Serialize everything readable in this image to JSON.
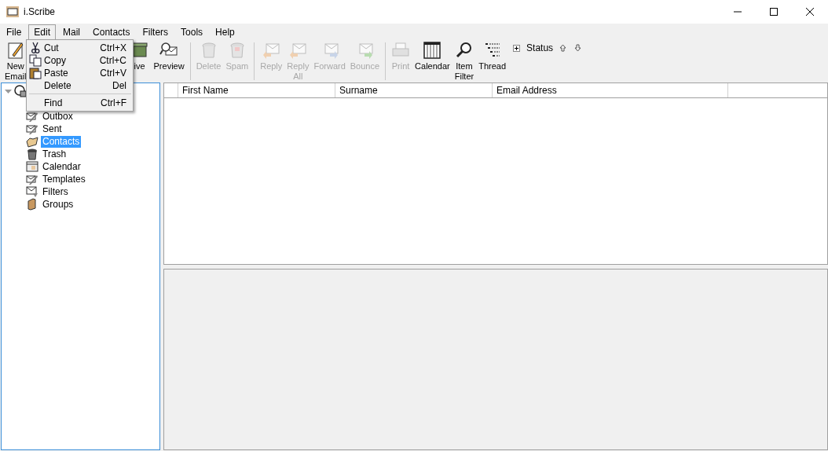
{
  "window": {
    "title": "i.Scribe"
  },
  "menu_bar": [
    {
      "label": "File",
      "selected": false
    },
    {
      "label": "Edit",
      "selected": true
    },
    {
      "label": "Mail",
      "selected": false
    },
    {
      "label": "Contacts",
      "selected": false
    },
    {
      "label": "Filters",
      "selected": false
    },
    {
      "label": "Tools",
      "selected": false
    },
    {
      "label": "Help",
      "selected": false
    }
  ],
  "edit_menu": [
    {
      "kind": "item",
      "label": "Cut",
      "shortcut": "Ctrl+X"
    },
    {
      "kind": "item",
      "label": "Copy",
      "shortcut": "Ctrl+C"
    },
    {
      "kind": "item",
      "label": "Paste",
      "shortcut": "Ctrl+V"
    },
    {
      "kind": "item",
      "label": "Delete",
      "shortcut": "Del"
    },
    {
      "kind": "separator"
    },
    {
      "kind": "item",
      "label": "Find",
      "shortcut": "Ctrl+F"
    }
  ],
  "toolbar": [
    {
      "kind": "button",
      "label": "New Email",
      "disabled": false
    },
    {
      "kind": "gap"
    },
    {
      "kind": "button",
      "label": "ive",
      "disabled": false
    },
    {
      "kind": "button",
      "label": "Preview",
      "disabled": false
    },
    {
      "kind": "separator"
    },
    {
      "kind": "button",
      "label": "Delete",
      "disabled": true
    },
    {
      "kind": "button",
      "label": "Spam",
      "disabled": true
    },
    {
      "kind": "separator"
    },
    {
      "kind": "button",
      "label": "Reply",
      "disabled": true
    },
    {
      "kind": "button",
      "label": "Reply All",
      "disabled": true
    },
    {
      "kind": "button",
      "label": "Forward",
      "disabled": true
    },
    {
      "kind": "button",
      "label": "Bounce",
      "disabled": true
    },
    {
      "kind": "separator"
    },
    {
      "kind": "button",
      "label": "Print",
      "disabled": true
    },
    {
      "kind": "button",
      "label": "Calendar",
      "disabled": false
    },
    {
      "kind": "button",
      "label": "Item Filter",
      "disabled": false
    },
    {
      "kind": "button",
      "label": "Thread",
      "disabled": false
    }
  ],
  "status_filter": {
    "label": "Status",
    "expanded": false
  },
  "folders": {
    "expanded": true,
    "children": [
      {
        "label": "Outbox",
        "selected": false
      },
      {
        "label": "Sent",
        "selected": false
      },
      {
        "label": "Contacts",
        "selected": true
      },
      {
        "label": "Trash",
        "selected": false
      },
      {
        "label": "Calendar",
        "selected": false
      },
      {
        "label": "Templates",
        "selected": false
      },
      {
        "label": "Filters",
        "selected": false
      },
      {
        "label": "Groups",
        "selected": false
      }
    ]
  },
  "table": {
    "columns": [
      "First Name",
      "Surname",
      "Email Address"
    ]
  }
}
